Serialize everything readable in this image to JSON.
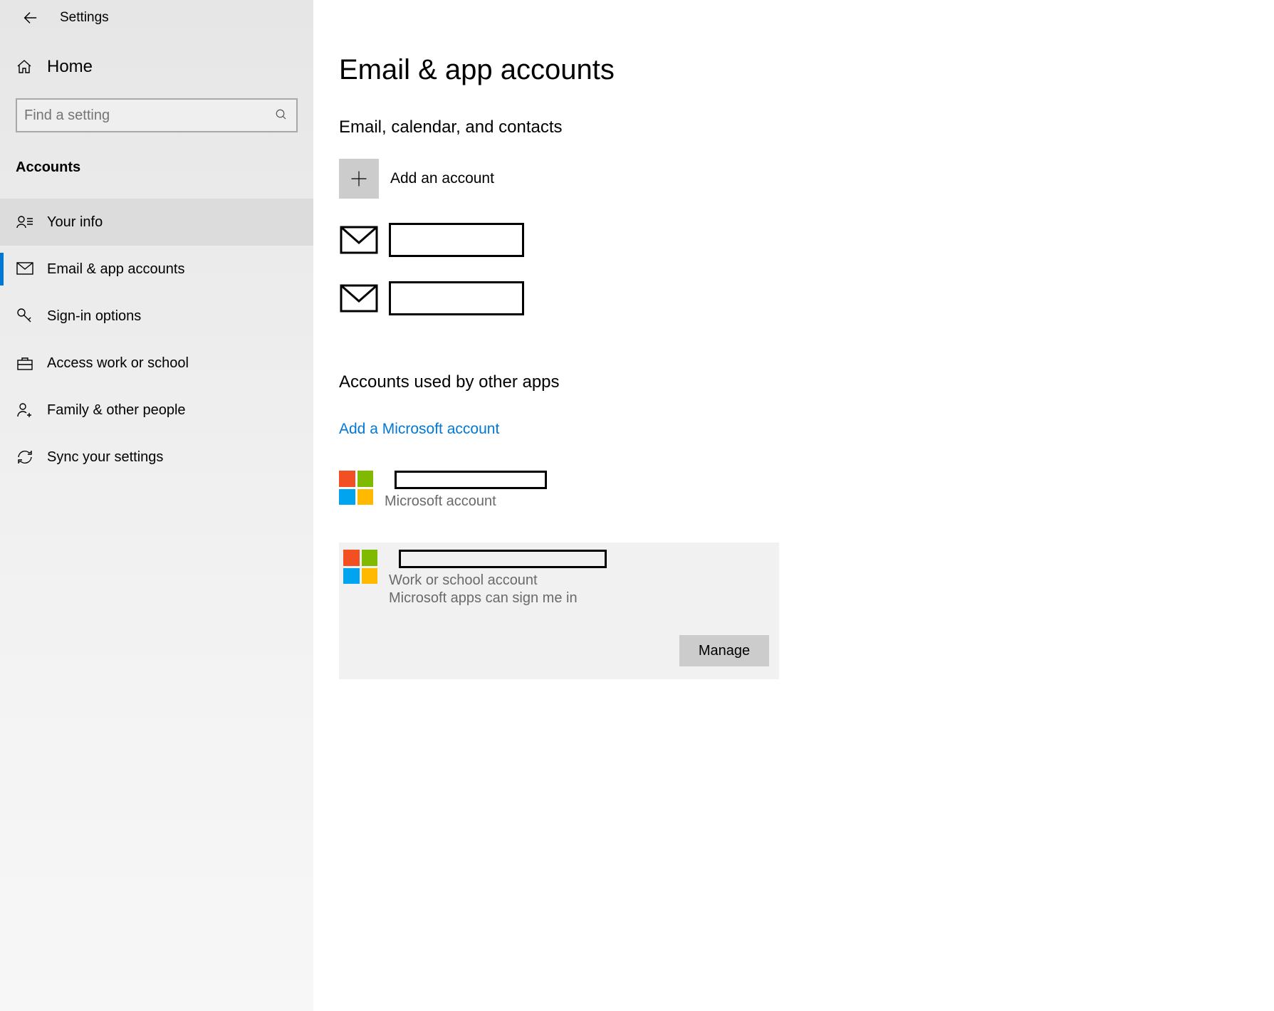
{
  "header": {
    "title": "Settings"
  },
  "sidebar": {
    "home_label": "Home",
    "section_label": "Accounts",
    "search_placeholder": "Find a setting",
    "items": [
      {
        "label": "Your info"
      },
      {
        "label": "Email & app accounts"
      },
      {
        "label": "Sign-in options"
      },
      {
        "label": "Access work or school"
      },
      {
        "label": "Family & other people"
      },
      {
        "label": "Sync your settings"
      }
    ]
  },
  "main": {
    "title": "Email & app accounts",
    "section1": "Email, calendar, and contacts",
    "add_account": "Add an account",
    "section2": "Accounts used by other apps",
    "add_ms_link": "Add a Microsoft account",
    "accounts": [
      {
        "type": "Microsoft account",
        "detail": ""
      },
      {
        "type": "Work or school account",
        "detail": "Microsoft apps can sign me in"
      }
    ],
    "manage_label": "Manage"
  }
}
